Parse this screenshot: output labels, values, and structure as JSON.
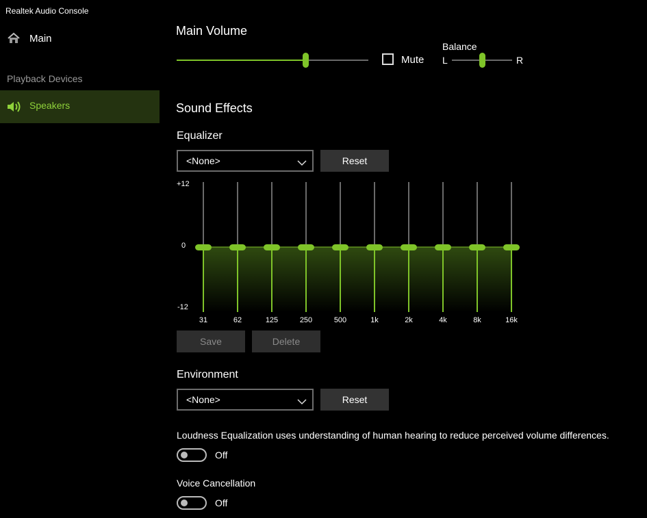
{
  "app": {
    "title": "Realtek Audio Console"
  },
  "sidebar": {
    "main_label": "Main",
    "section_label": "Playback Devices",
    "device_label": "Speakers"
  },
  "main_volume": {
    "title": "Main Volume",
    "level_percent": 67,
    "mute_label": "Mute",
    "mute_checked": false,
    "balance_label": "Balance",
    "balance_left": "L",
    "balance_right": "R",
    "balance_position": 0.5
  },
  "sound_effects": {
    "title": "Sound Effects",
    "equalizer": {
      "label": "Equalizer",
      "preset": "<None>",
      "reset_label": "Reset",
      "scale_top": "+12",
      "scale_mid": "0",
      "scale_bottom": "-12",
      "bands": [
        "31",
        "62",
        "125",
        "250",
        "500",
        "1k",
        "2k",
        "4k",
        "8k",
        "16k"
      ],
      "gains_db": [
        0,
        0,
        0,
        0,
        0,
        0,
        0,
        0,
        0,
        0
      ],
      "save_label": "Save",
      "delete_label": "Delete"
    },
    "environment": {
      "label": "Environment",
      "preset": "<None>",
      "reset_label": "Reset"
    },
    "loudness": {
      "description": "Loudness Equalization uses understanding of human hearing to reduce perceived volume differences.",
      "state_label": "Off",
      "enabled": false
    },
    "voice_cancellation": {
      "label": "Voice Cancellation",
      "state_label": "Off",
      "enabled": false
    }
  },
  "colors": {
    "accent": "#7fc429",
    "selected_bg": "#243310",
    "track": "#6a6a6a"
  }
}
